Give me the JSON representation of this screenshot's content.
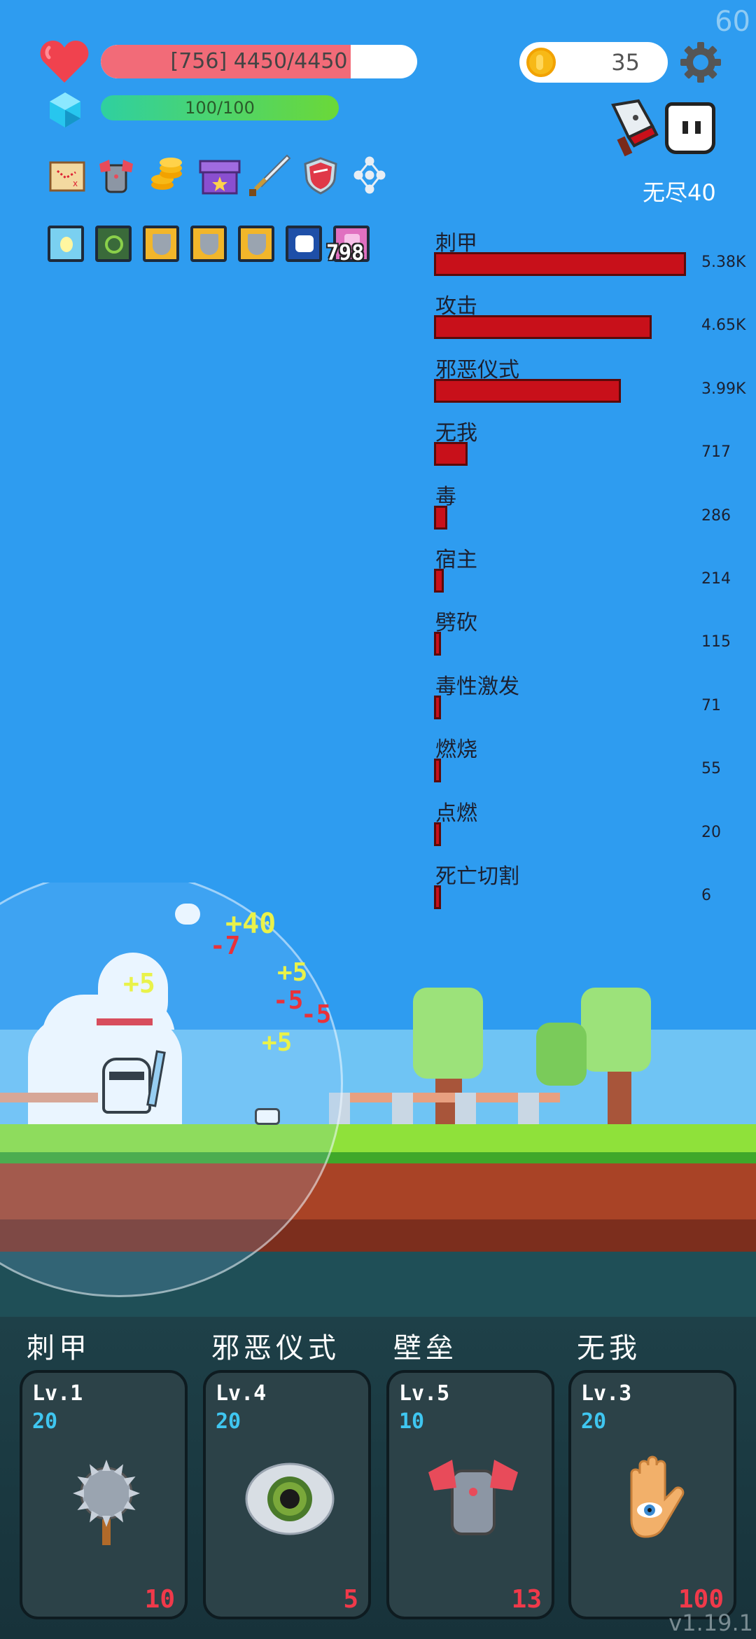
{
  "fps": "60",
  "player": {
    "hp_text": "[756] 4450/4450",
    "hp_fraction": 0.79,
    "mp_text": "100/100",
    "mp_fraction": 1.0
  },
  "coins": "35",
  "mode_label": "无尽40",
  "relic_count": "798",
  "icons_row1": [
    "map-icon",
    "armor-icon",
    "coins-stack-icon",
    "chest-icon",
    "sword-icon",
    "shield-icon",
    "network-icon"
  ],
  "icons_row2": [
    "glow-relic-icon",
    "vine-relic-icon",
    "silver-shield-relic-icon",
    "silver-shield-relic-icon",
    "silver-shield-relic-icon",
    "frost-relic-icon",
    "pink-relic-icon"
  ],
  "damage_stats": [
    {
      "name": "刺甲",
      "value": "5.38K",
      "amount": 5380
    },
    {
      "name": "攻击",
      "value": "4.65K",
      "amount": 4650
    },
    {
      "name": "邪恶仪式",
      "value": "3.99K",
      "amount": 3990
    },
    {
      "name": "无我",
      "value": "717",
      "amount": 717
    },
    {
      "name": "毒",
      "value": "286",
      "amount": 286
    },
    {
      "name": "宿主",
      "value": "214",
      "amount": 214
    },
    {
      "name": "劈砍",
      "value": "115",
      "amount": 115
    },
    {
      "name": "毒性激发",
      "value": "71",
      "amount": 71
    },
    {
      "name": "燃烧",
      "value": "55",
      "amount": 55
    },
    {
      "name": "点燃",
      "value": "20",
      "amount": 20
    },
    {
      "name": "死亡切割",
      "value": "6",
      "amount": 6
    }
  ],
  "floating_numbers": [
    {
      "text": "+40",
      "color": "#E9F24A"
    },
    {
      "text": "-7",
      "color": "#E8323A"
    },
    {
      "text": "+5",
      "color": "#E9F24A"
    },
    {
      "text": "+5",
      "color": "#E9F24A"
    },
    {
      "text": "-5",
      "color": "#E8323A"
    },
    {
      "text": "-5",
      "color": "#E8323A"
    },
    {
      "text": "+5",
      "color": "#E9F24A"
    }
  ],
  "skills": [
    {
      "title": "刺甲",
      "level": "Lv.1",
      "cost": "20",
      "price": "10",
      "icon": "spiked-mace-icon"
    },
    {
      "title": "邪恶仪式",
      "level": "Lv.4",
      "cost": "20",
      "price": "5",
      "icon": "eye-icon"
    },
    {
      "title": "壁垒",
      "level": "Lv.5",
      "cost": "10",
      "price": "13",
      "icon": "armor-icon"
    },
    {
      "title": "无我",
      "level": "Lv.3",
      "cost": "20",
      "price": "100",
      "icon": "hamsa-hand-icon"
    }
  ],
  "version": "v1.19.1"
}
